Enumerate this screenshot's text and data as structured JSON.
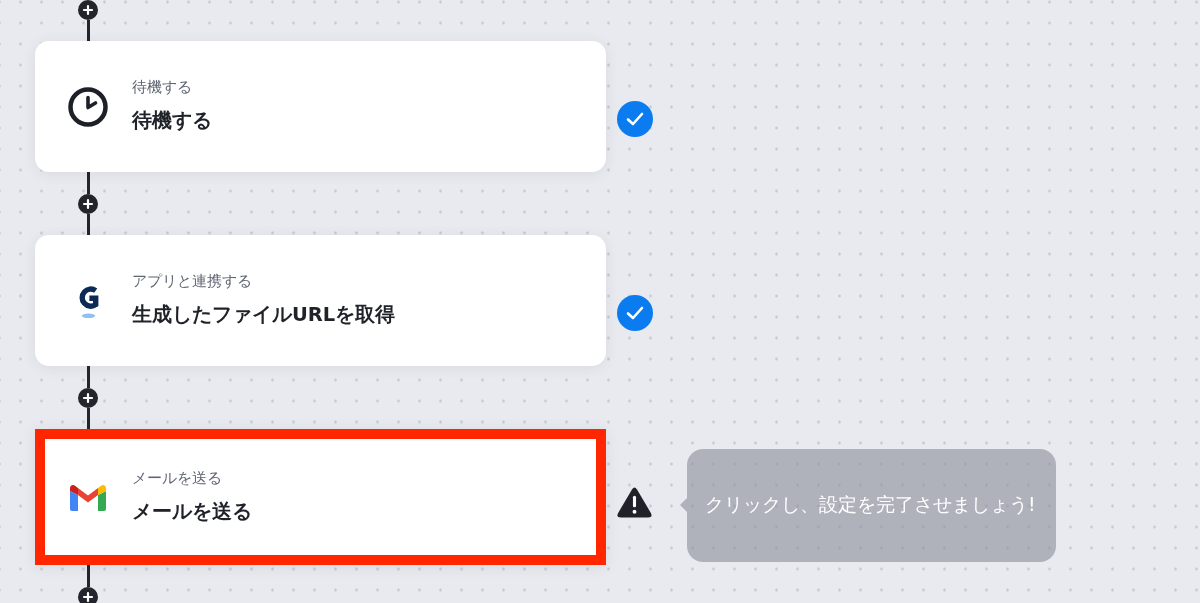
{
  "flow": {
    "steps": [
      {
        "kind": "wait",
        "category": "待機する",
        "title": "待機する",
        "complete": true,
        "highlighted": false
      },
      {
        "kind": "app",
        "category": "アプリと連携する",
        "title": "生成したファイルURLを取得",
        "complete": true,
        "highlighted": false
      },
      {
        "kind": "mail",
        "category": "メールを送る",
        "title": "メールを送る",
        "complete": false,
        "highlighted": true,
        "tooltip": "クリックし、設定を完了させましょう!"
      }
    ]
  }
}
